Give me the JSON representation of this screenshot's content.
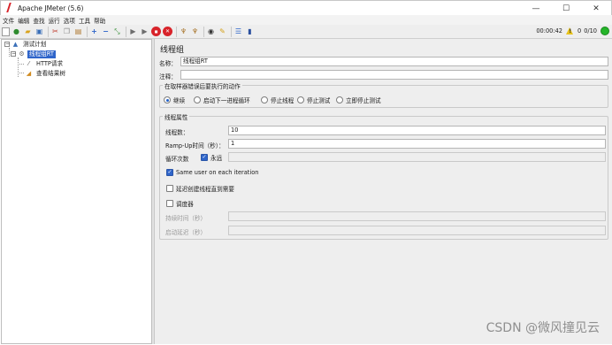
{
  "window": {
    "title": "Apache JMeter (5.6)",
    "controls": {
      "minimize": "—",
      "maximize": "☐",
      "close": "✕"
    }
  },
  "menu": [
    "文件",
    "编辑",
    "查找",
    "运行",
    "选项",
    "工具",
    "帮助"
  ],
  "toolbar": {
    "timer": "00:00:42",
    "warnings": "0",
    "threads": "0/10",
    "status_color": "#25b52a"
  },
  "tree": {
    "root": {
      "label": "测试计划",
      "icon": "test-plan-icon",
      "expander": "−"
    },
    "thread_group": {
      "label": "线程组RT",
      "icon": "gear-icon",
      "expander": "−"
    },
    "children": [
      {
        "label": "HTTP请求",
        "icon": "pipette-icon"
      },
      {
        "label": "查看结果树",
        "icon": "chart-icon"
      }
    ]
  },
  "panel": {
    "title": "线程组",
    "name_label": "名称：",
    "name_value": "线程组RT",
    "comment_label": "注释：",
    "comment_value": "",
    "on_error": {
      "title": "在取样器错误后要执行的动作",
      "options": [
        "继续",
        "启动下一进程循环",
        "停止线程",
        "停止测试",
        "立即停止测试"
      ],
      "selected": "继续"
    },
    "props": {
      "title": "线程属性",
      "threads_label": "线程数：",
      "threads_value": "10",
      "rampup_label": "Ramp-Up时间（秒）：",
      "rampup_value": "1",
      "loop_label": "循环次数",
      "forever_label": "永远",
      "forever_checked": true,
      "loop_value": "",
      "same_user_label": "Same user on each iteration",
      "same_user_checked": true,
      "delay_label": "延迟创建线程直到需要",
      "delay_checked": false,
      "scheduler_label": "调度器",
      "scheduler_checked": false,
      "duration_label": "持续时间（秒）",
      "duration_value": "",
      "startup_delay_label": "启动延迟（秒）",
      "startup_delay_value": ""
    }
  },
  "watermark": "CSDN @微风撞见云"
}
